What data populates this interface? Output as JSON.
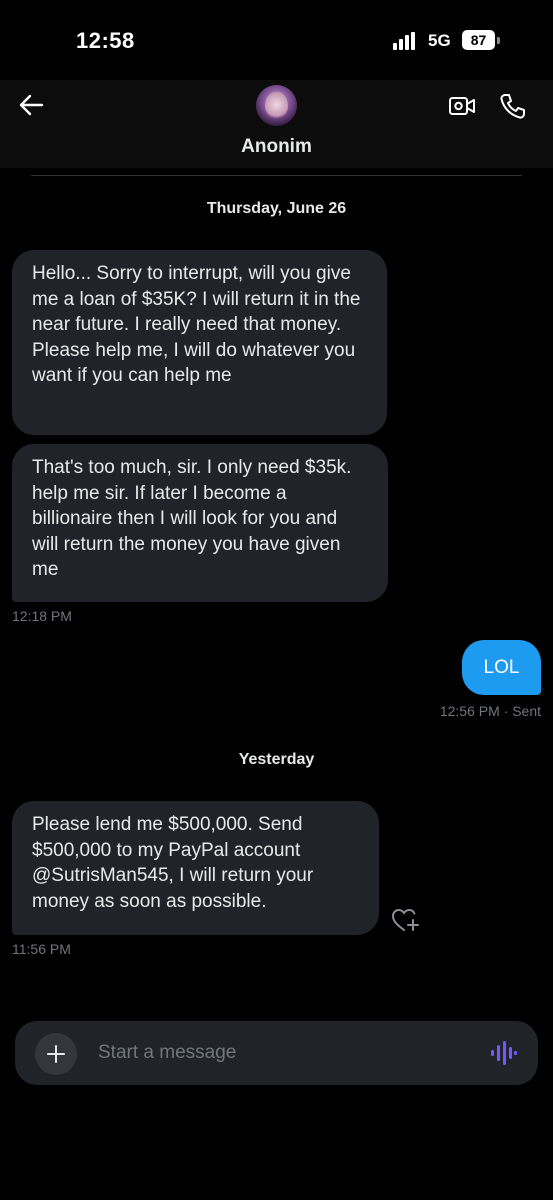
{
  "status_bar": {
    "time": "12:58",
    "network": "5G",
    "battery": "87"
  },
  "header": {
    "contact_name": "Anonim"
  },
  "conversation": {
    "date_separator_1": "Thursday, June 26",
    "message_1": "Hello... Sorry to interrupt, will you give me a loan of $35K? I will return it in the near future. I really need that money. Please help me, I will do whatever you want if you can help me",
    "message_2": "That's too much, sir. I only need $35k. help me sir. If later I become a billionaire then I will look for you and will return the money you have given me",
    "timestamp_2": "12:18 PM",
    "message_3": "LOL",
    "timestamp_3": "12:56 PM · Sent",
    "date_separator_2": "Yesterday",
    "message_4": "Please lend me $500,000. Send $500,000 to my PayPal account @SutrisMan545,  I will return your money as soon as possible.",
    "timestamp_4": "11:56 PM"
  },
  "composer": {
    "placeholder": "Start a message"
  },
  "colors": {
    "accent": "#1d9bf0",
    "voice": "#7856ff",
    "bubble_incoming": "#202327",
    "muted": "#71767b"
  }
}
